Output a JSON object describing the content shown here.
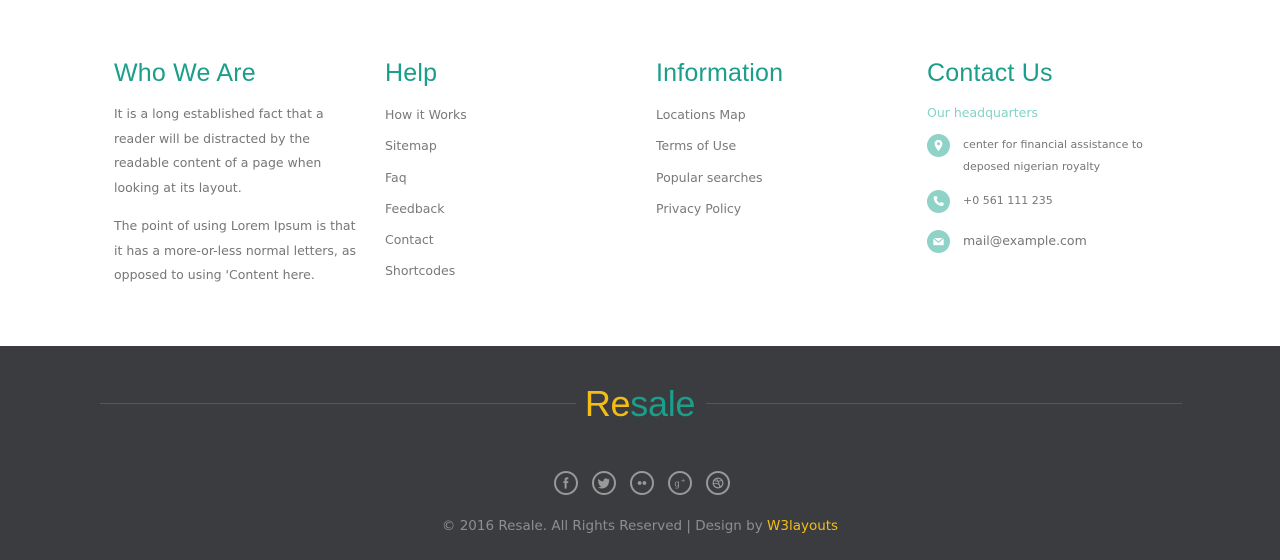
{
  "who_we_are": {
    "title": "Who We Are",
    "para1": "It is a long established fact that a reader will be distracted by the readable content of a page when looking at its layout.",
    "para2": "The point of using Lorem Ipsum is that it has a more-or-less normal letters, as opposed to using 'Content here."
  },
  "help": {
    "title": "Help",
    "links": [
      "How it Works",
      "Sitemap",
      "Faq",
      "Feedback",
      "Contact",
      "Shortcodes"
    ]
  },
  "information": {
    "title": "Information",
    "links": [
      "Locations Map",
      "Terms of Use",
      "Popular searches",
      "Privacy Policy"
    ]
  },
  "contact": {
    "title": "Contact Us",
    "subtitle": "Our headquarters",
    "address": "center for financial assistance to deposed nigerian royalty",
    "phone": "+0 561 111 235",
    "email": "mail@example.com",
    "icons": [
      "location-pin-icon",
      "phone-icon",
      "envelope-icon"
    ]
  },
  "brand": {
    "part1": "Re",
    "part2": "sale"
  },
  "social_icons": [
    "facebook-icon",
    "twitter-icon",
    "flickr-icon",
    "google-plus-icon",
    "dribbble-icon"
  ],
  "copyright": {
    "text": "© 2016 Resale. All Rights Reserved | Design by",
    "link": "W3layouts"
  },
  "colors": {
    "accent_teal": "#1b9e8a",
    "accent_yellow": "#f3bd16",
    "icon_teal": "#8fd2c7",
    "footer_dark": "#3b3c40"
  }
}
